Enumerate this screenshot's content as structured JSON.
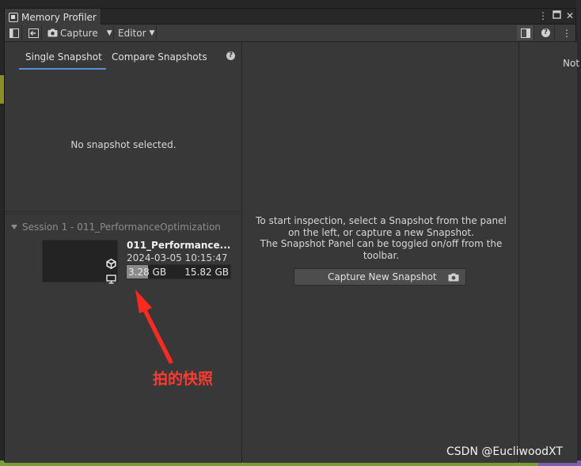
{
  "window": {
    "tab_title": "Memory Profiler",
    "title_icons": [
      "more-vert-icon",
      "maximize-icon",
      "close-icon"
    ]
  },
  "toolbar": {
    "capture_label": "Capture",
    "target_label": "Editor"
  },
  "left_panel": {
    "tabs": [
      {
        "label": "Single Snapshot",
        "active": true
      },
      {
        "label": "Compare Snapshots",
        "active": false
      }
    ],
    "empty_message": "No snapshot selected.",
    "session": {
      "label": "Session 1 - 011_PerformanceOptimization",
      "snapshots": [
        {
          "name": "011_Performance...",
          "date": "2024-03-05 10:15:47",
          "used_memory": "3.28",
          "used_unit": "GB",
          "total_memory": "15.82 GB",
          "used_fraction": 0.207
        }
      ]
    }
  },
  "center_panel": {
    "instructions": [
      "To start inspection, select a Snapshot from the panel",
      "on the left, or capture a new Snapshot.",
      "The Snapshot Panel can be toggled on/off from the",
      "toolbar."
    ],
    "capture_button": "Capture New Snapshot"
  },
  "right_panel": {
    "text": "Not"
  },
  "annotation": {
    "text": "拍的快照",
    "color": "#ff3b2f"
  },
  "watermark": "CSDN @EucliwoodXT",
  "colors": {
    "accent": "#5a8fd6",
    "panel": "#383838",
    "toolbar": "#3c3c3c"
  }
}
